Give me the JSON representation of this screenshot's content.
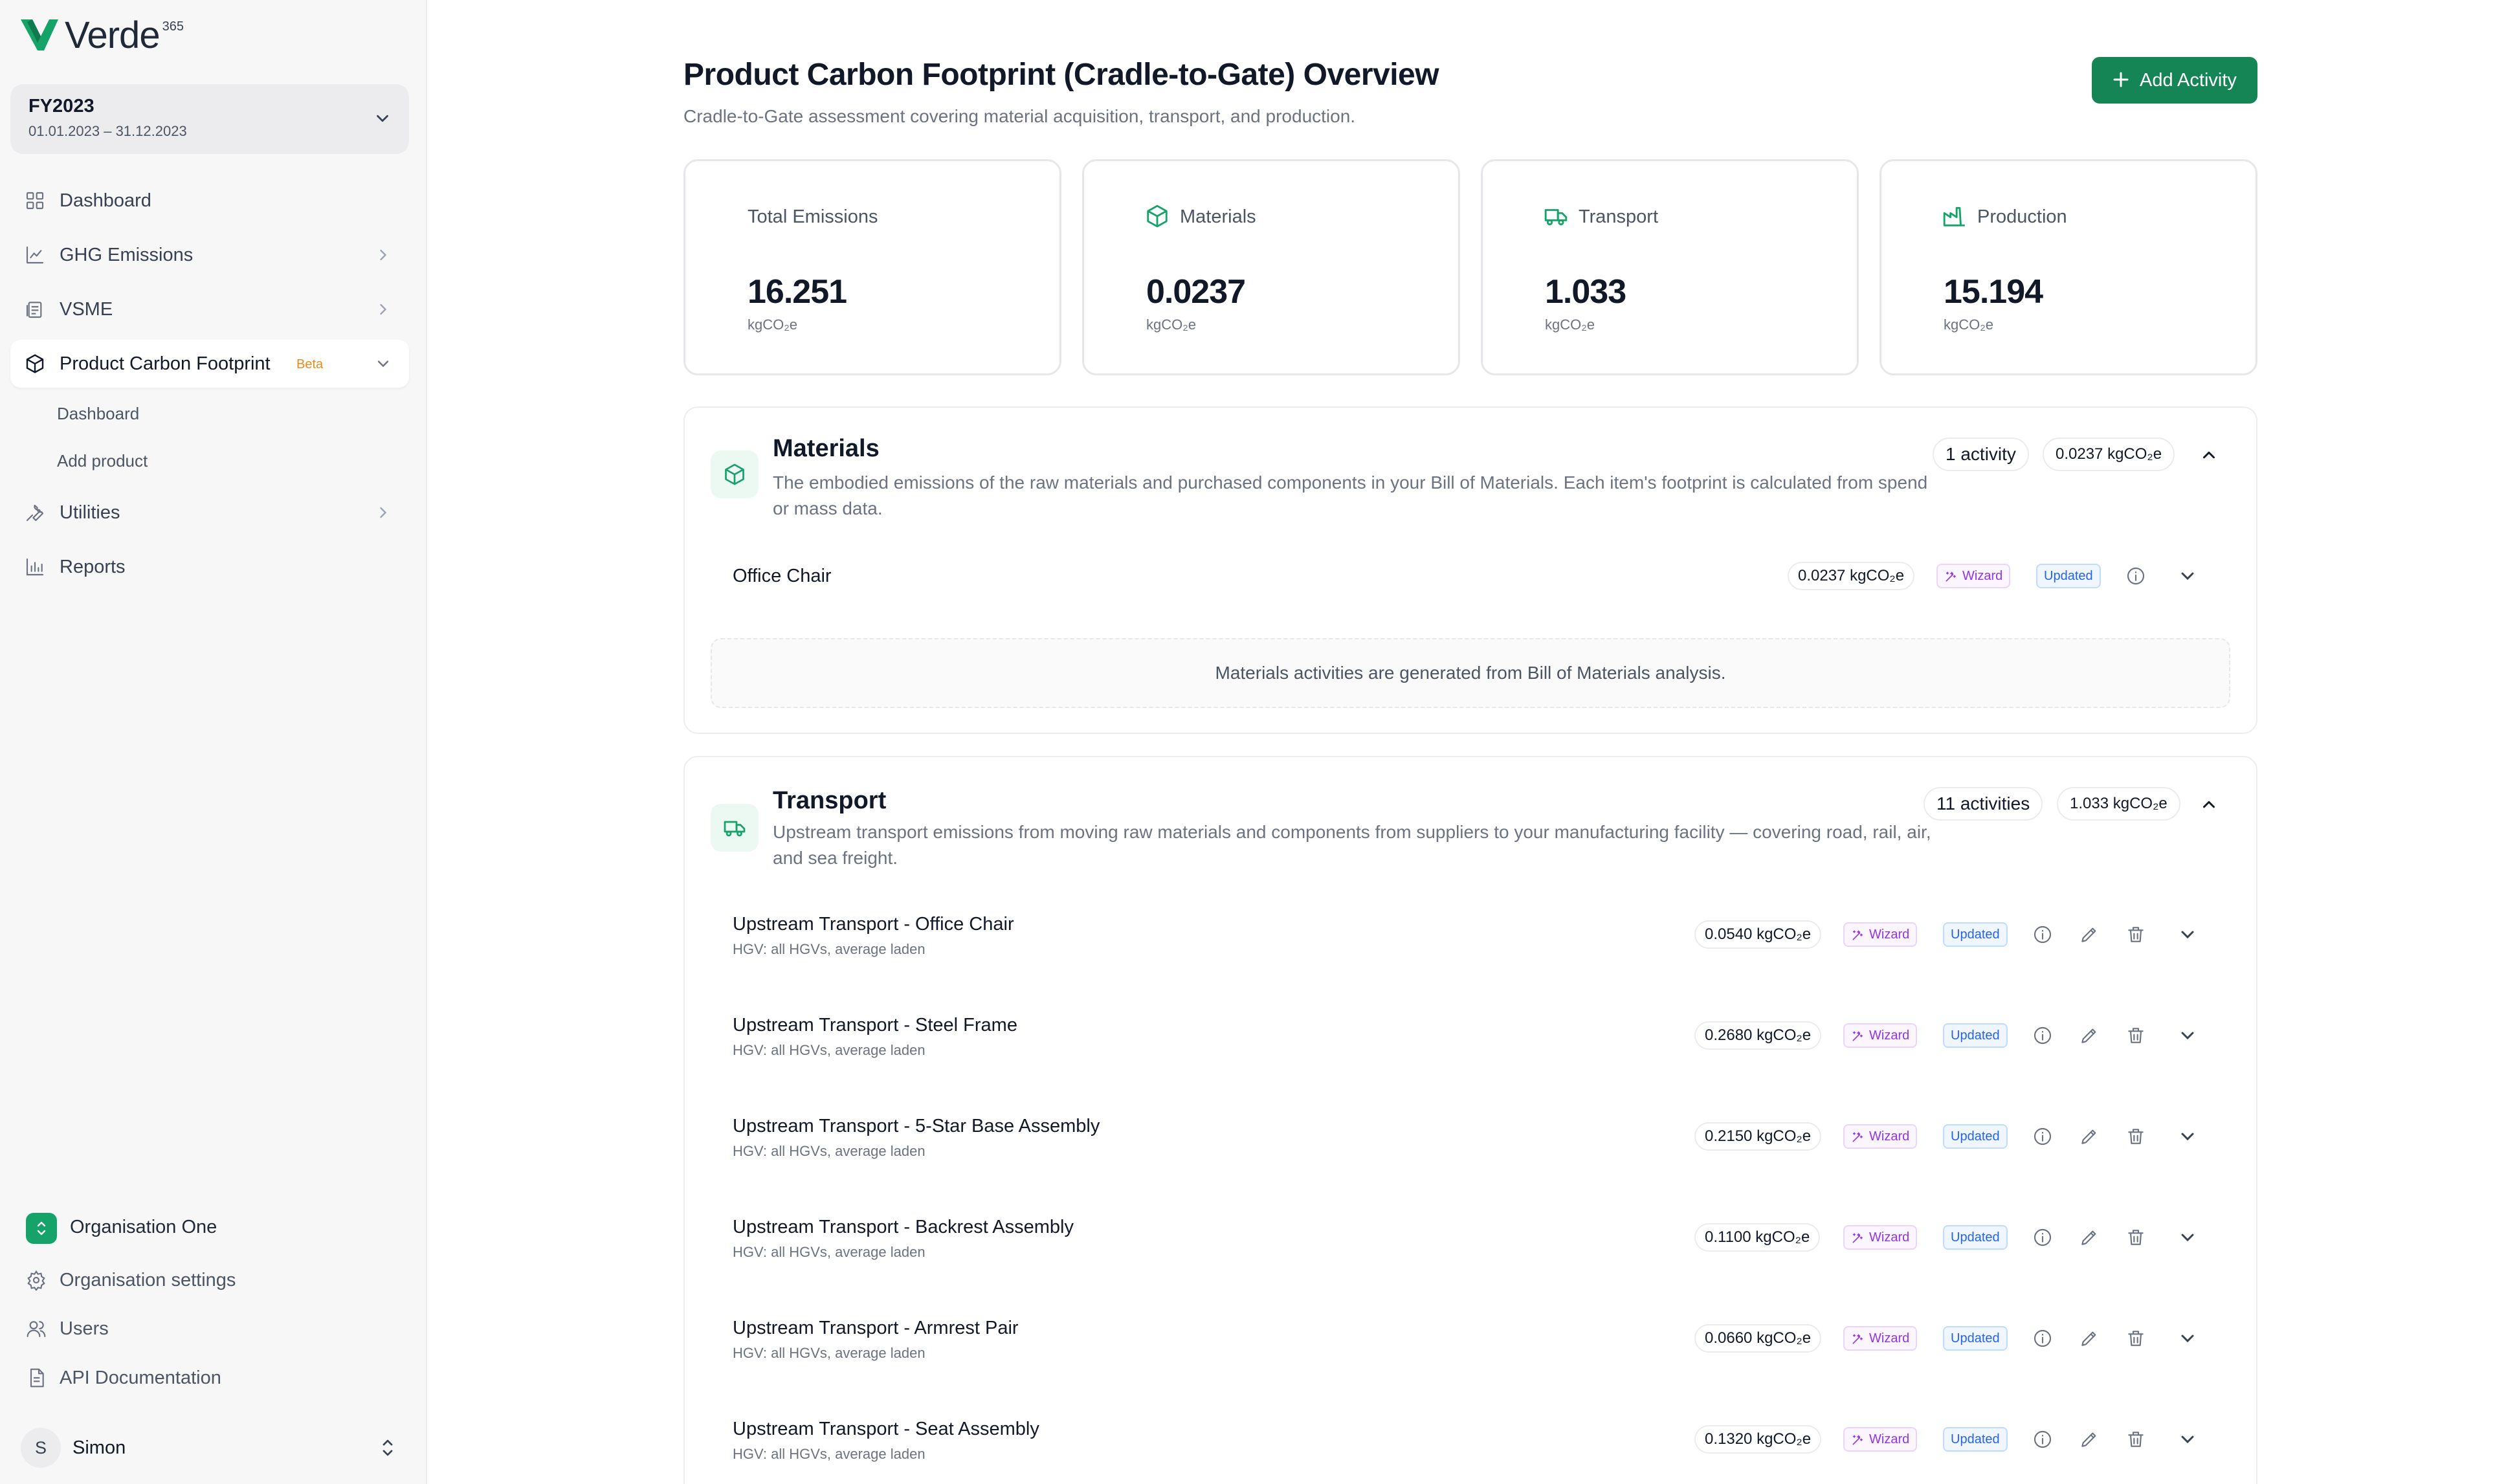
{
  "brand": {
    "name": "Verde",
    "sup": "365",
    "color": "#16a36a"
  },
  "fiscal_year": {
    "label": "FY2023",
    "range": "01.01.2023 – 31.12.2023"
  },
  "nav": {
    "dashboard": "Dashboard",
    "ghg": "GHG Emissions",
    "vsme": "VSME",
    "pcf": "Product Carbon Footprint",
    "pcf_badge": "Beta",
    "pcf_sub": [
      "Dashboard",
      "Add product"
    ],
    "utilities": "Utilities",
    "reports": "Reports"
  },
  "footer": {
    "org": "Organisation One",
    "org_settings": "Organisation settings",
    "users": "Users",
    "api": "API Documentation",
    "user_initial": "S",
    "user_name": "Simon"
  },
  "header": {
    "title": "Product Carbon Footprint (Cradle-to-Gate) Overview",
    "subtitle": "Cradle-to-Gate assessment covering material acquisition, transport, and production.",
    "add_button": "Add Activity"
  },
  "stats": [
    {
      "label": "Total Emissions",
      "value": "16.251",
      "unit": "kgCO₂e",
      "icon": ""
    },
    {
      "label": "Materials",
      "value": "0.0237",
      "unit": "kgCO₂e",
      "icon": "box-icon"
    },
    {
      "label": "Transport",
      "value": "1.033",
      "unit": "kgCO₂e",
      "icon": "truck-icon"
    },
    {
      "label": "Production",
      "value": "15.194",
      "unit": "kgCO₂e",
      "icon": "factory-icon"
    }
  ],
  "materials": {
    "title": "Materials",
    "description": "The embodied emissions of the raw materials and purchased components in your Bill of Materials. Each item's footprint is calculated from spend or mass data.",
    "count": "1 activity",
    "total": "0.0237 kgCO₂e",
    "rows": [
      {
        "title": "Office Chair",
        "value": "0.0237 kgCO₂e",
        "wizard": "Wizard",
        "status": "Updated"
      }
    ],
    "note": "Materials activities are generated from Bill of Materials analysis."
  },
  "transport": {
    "title": "Transport",
    "description": "Upstream transport emissions from moving raw materials and components from suppliers to your manufacturing facility — covering road, rail, air, and sea freight.",
    "count": "11 activities",
    "total": "1.033 kgCO₂e",
    "rows": [
      {
        "title": "Upstream Transport - Office Chair",
        "sub": "HGV: all HGVs, average laden",
        "value": "0.0540 kgCO₂e",
        "wizard": "Wizard",
        "status": "Updated"
      },
      {
        "title": "Upstream Transport - Steel Frame",
        "sub": "HGV: all HGVs, average laden",
        "value": "0.2680 kgCO₂e",
        "wizard": "Wizard",
        "status": "Updated"
      },
      {
        "title": "Upstream Transport - 5-Star Base Assembly",
        "sub": "HGV: all HGVs, average laden",
        "value": "0.2150 kgCO₂e",
        "wizard": "Wizard",
        "status": "Updated"
      },
      {
        "title": "Upstream Transport - Backrest Assembly",
        "sub": "HGV: all HGVs, average laden",
        "value": "0.1100 kgCO₂e",
        "wizard": "Wizard",
        "status": "Updated"
      },
      {
        "title": "Upstream Transport - Armrest Pair",
        "sub": "HGV: all HGVs, average laden",
        "value": "0.0660 kgCO₂e",
        "wizard": "Wizard",
        "status": "Updated"
      },
      {
        "title": "Upstream Transport - Seat Assembly",
        "sub": "HGV: all HGVs, average laden",
        "value": "0.1320 kgCO₂e",
        "wizard": "Wizard",
        "status": "Updated"
      }
    ]
  }
}
